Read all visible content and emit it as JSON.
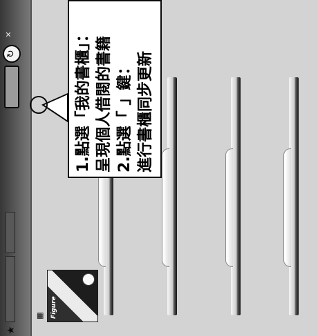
{
  "topbar": {
    "tab_bookshelf": "",
    "tab_borrowed": "",
    "tab_my_bookshelf": "",
    "sync_icon": "↻",
    "close_icon": "✕",
    "star_icon": "★"
  },
  "content": {
    "grid_icon": "▦",
    "book_cover_text": "Figure"
  },
  "callout": {
    "lines": [
      "1.點選「我的書櫃」：",
      "呈現個人借閱的書籍",
      "2.點選「 」鍵：",
      "進行書櫃同步更新"
    ]
  },
  "colors": {
    "callout_border": "#111111",
    "callout_bg": "#ffffff",
    "topbar": "#4a4a4a"
  }
}
